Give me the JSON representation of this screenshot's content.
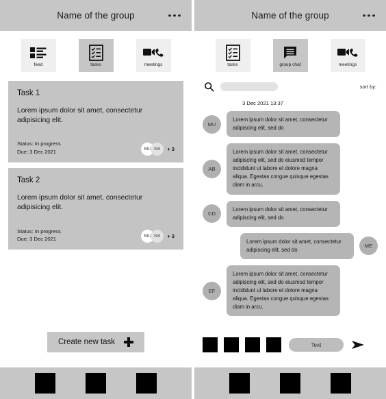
{
  "left": {
    "header": {
      "title": "Name of the group",
      "menu_icon": "kebab-menu-icon"
    },
    "tabs": [
      {
        "label": "feed",
        "icon": "feed-icon",
        "active": false
      },
      {
        "label": "tasks",
        "icon": "checklist-icon",
        "active": true
      },
      {
        "label": "meetings",
        "icon": "video-call-icon",
        "active": false
      }
    ],
    "tasks": [
      {
        "title": "Task 1",
        "body": "Lorem ipsum dolor sit amet, consectetur adipisicing elit.",
        "status": "Status: In progress",
        "due": "Due: 3 Dec 2021",
        "avatars": [
          "MU",
          "NS"
        ],
        "more": "+ 3"
      },
      {
        "title": "Task 2",
        "body": "Lorem ipsum dolor sit amet, consectetur adipisicing elit.",
        "status": "Status: In progress",
        "due": "Due: 3 Dec 2021",
        "avatars": [
          "MU",
          "NS"
        ],
        "more": "+ 3"
      }
    ],
    "create_button": {
      "label": "Create new task",
      "icon": "plus-icon"
    },
    "bottom_nav": [
      "nav-item-1",
      "nav-item-2",
      "nav-item-3"
    ]
  },
  "right": {
    "header": {
      "title": "Name of the group",
      "menu_icon": "kebab-menu-icon"
    },
    "tabs": [
      {
        "label": "tasks",
        "icon": "checklist-icon",
        "active": false
      },
      {
        "label": "group chat",
        "icon": "chat-bubble-icon",
        "active": true
      },
      {
        "label": "meetings",
        "icon": "video-call-icon",
        "active": false
      }
    ],
    "search": {
      "icon": "search-icon",
      "value": "",
      "placeholder": ""
    },
    "sort": {
      "label": "sort by:"
    },
    "chat": {
      "date": "3 Dec 2021 13:37",
      "messages": [
        {
          "avatar": "MU",
          "side": "left",
          "text": "Lorem ipsum dolor sit amet, consectetur adipiscing elit, sed do"
        },
        {
          "avatar": "AB",
          "side": "left",
          "text": "Lorem ipsum dolor sit amet, consectetur adipiscing elit, sed do eiusmod tempor incididunt ut labore et dolore magna aliqua. Egestas congue quisque egestas diam in arcu."
        },
        {
          "avatar": "CD",
          "side": "left",
          "text": "Lorem ipsum dolor sit amet, consectetur adipiscing elit, sed do"
        },
        {
          "avatar": "ME",
          "side": "right",
          "text": "Lorem ipsum dolor sit amet, consectetur adipiscing elit, sed do"
        },
        {
          "avatar": "EF",
          "side": "left",
          "text": "Lorem ipsum dolor sit amet, consectetur adipiscing elit, sed do eiusmod tempor incididunt ut labore et dolore magna aliqua. Egestas congue quisque egestas diam in arcu."
        }
      ]
    },
    "composer": {
      "attachments": [
        "attach-1",
        "attach-2",
        "attach-3",
        "attach-4"
      ],
      "input_label": "Text",
      "send_icon": "send-arrow-icon"
    },
    "bottom_nav": [
      "nav-item-1",
      "nav-item-2",
      "nav-item-3"
    ]
  },
  "colors": {
    "header_gray": "#c6c6c6",
    "card_gray": "#c4c4c4",
    "bubble_gray": "#b5b5b5",
    "tab_inactive": "#efefef",
    "avatar_gray": "#b0b0b0",
    "black": "#000000"
  }
}
